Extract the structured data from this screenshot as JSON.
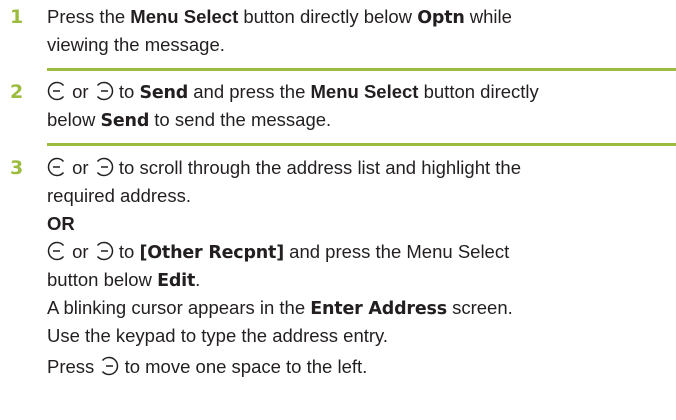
{
  "colors": {
    "step_number": "#9cbc3f",
    "rule": "#9cbc3f",
    "text": "#231f20"
  },
  "steps": [
    {
      "number": "1",
      "l1_a": "Press the ",
      "l1_b": "Menu Select",
      "l1_c": " button directly below ",
      "l1_d": "Optn",
      "l1_e": " while",
      "l2_a": "viewing the message."
    },
    {
      "number": "2",
      "l1_or": " or ",
      "l1_a": " to ",
      "l1_b": "Send",
      "l1_c": " and press the ",
      "l1_d": "Menu Select",
      "l1_e": " button directly",
      "l2_a": "below ",
      "l2_b": "Send",
      "l2_c": " to send the message."
    },
    {
      "number": "3",
      "l1_or": " or ",
      "l1_a": " to scroll through the address list and highlight the",
      "l2_a": "required address.",
      "l3_a": "OR",
      "l4_or": " or ",
      "l4_a": " to ",
      "l4_b": "[Other Recpnt]",
      "l4_c": " and press the Menu Select",
      "l5_a": "button below ",
      "l5_b": "Edit",
      "l5_c": ".",
      "l6_a": "A blinking cursor appears in the ",
      "l6_b": "Enter Address",
      "l6_c": " screen.",
      "l7_a": "Use the keypad to type the address entry.",
      "l8_a": "Press ",
      "l8_b": " to move one space to the left."
    }
  ],
  "icons": {
    "left": "nav-left-icon",
    "right": "nav-right-icon"
  }
}
